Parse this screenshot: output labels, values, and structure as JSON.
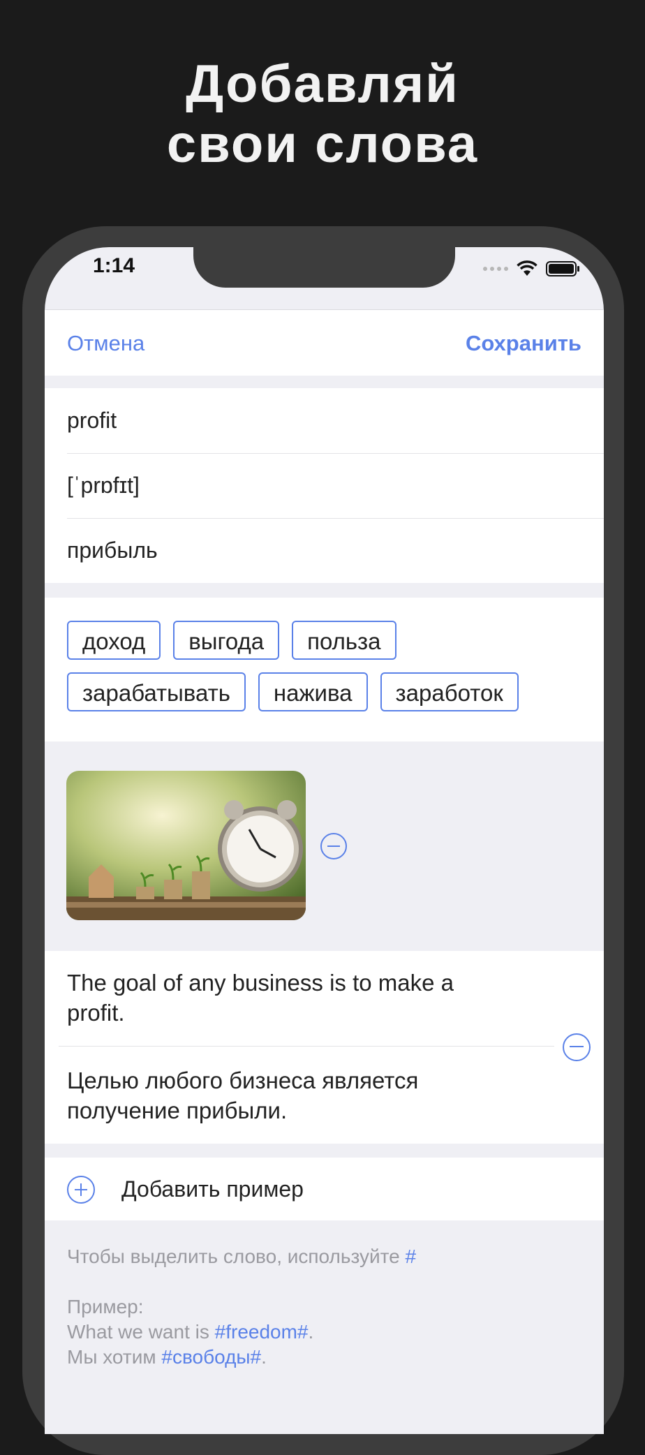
{
  "headline": {
    "line1": "Добавляй",
    "line2": "свои слова"
  },
  "status_bar": {
    "time": "1:14"
  },
  "nav": {
    "cancel_label": "Отмена",
    "save_label": "Сохранить"
  },
  "word_fields": {
    "word": "profit",
    "transcription": "[ˈprɒfɪt]",
    "translation": "прибыль"
  },
  "synonyms": {
    "row1": [
      "доход",
      "выгода",
      "польза"
    ],
    "row2": [
      "зарабатывать",
      "нажива",
      "заработок"
    ]
  },
  "image": {
    "description_icon": "photo"
  },
  "example": {
    "original": "The goal of any business is to make a profit.",
    "translation": "Целью любого бизнеса является получение прибыли."
  },
  "add_example_label": "Добавить пример",
  "hint": {
    "line1_prefix": "Чтобы выделить слово, используйте",
    "line1_symbol": "#",
    "example_label": "Пример:",
    "line3_prefix": "What we want is",
    "line3_highlight": "#freedom#",
    "line3_suffix": ".",
    "line4_prefix": "Мы хотим",
    "line4_highlight": "#свободы#",
    "line4_suffix": "."
  },
  "colors": {
    "accent": "#5a81e8",
    "background": "#1b1b1b",
    "screen_bg": "#efeff4"
  }
}
